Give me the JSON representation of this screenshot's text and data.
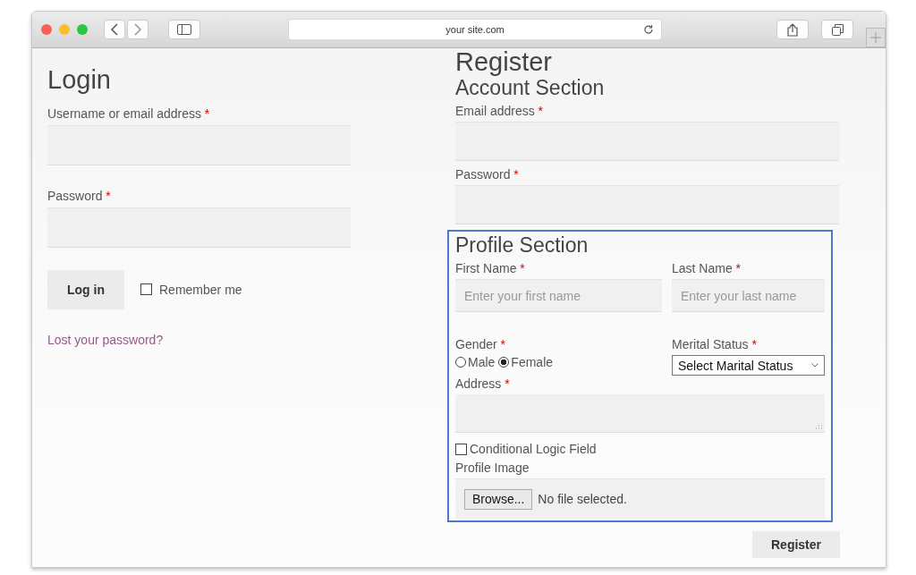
{
  "browser": {
    "url": "your site.com"
  },
  "login": {
    "title": "Login",
    "fields": [
      {
        "label": "Username or email address",
        "mark": "*"
      },
      {
        "label": "Password",
        "mark": "*"
      }
    ],
    "button": "Log in",
    "remember": {
      "label": "Remember me",
      "checked": false
    },
    "lost_password": "Lost your password?"
  },
  "register": {
    "title": "Register",
    "account": {
      "title": "Account Section",
      "fields": [
        {
          "label": "Email address",
          "mark": "*"
        },
        {
          "label": "Password",
          "mark": "*"
        }
      ]
    },
    "profile": {
      "title": "Profile Section",
      "first_name": {
        "label": "First Name",
        "mark": "*",
        "placeholder": "Enter your first name"
      },
      "last_name": {
        "label": "Last Name",
        "mark": "*",
        "placeholder": "Enter your last name"
      },
      "gender": {
        "label": "Gender",
        "mark": "*",
        "options": [
          {
            "label": "Male",
            "selected": false
          },
          {
            "label": "Female",
            "selected": true
          }
        ]
      },
      "marital": {
        "label": "Merital Status",
        "mark": "*",
        "value": "Select Marital Status"
      },
      "address": {
        "label": "Address",
        "mark": "*"
      },
      "conditional": {
        "label": "Conditional Logic Field",
        "checked": false
      },
      "image": {
        "label": "Profile Image",
        "button": "Browse...",
        "status": "No file selected."
      }
    },
    "button": "Register"
  }
}
